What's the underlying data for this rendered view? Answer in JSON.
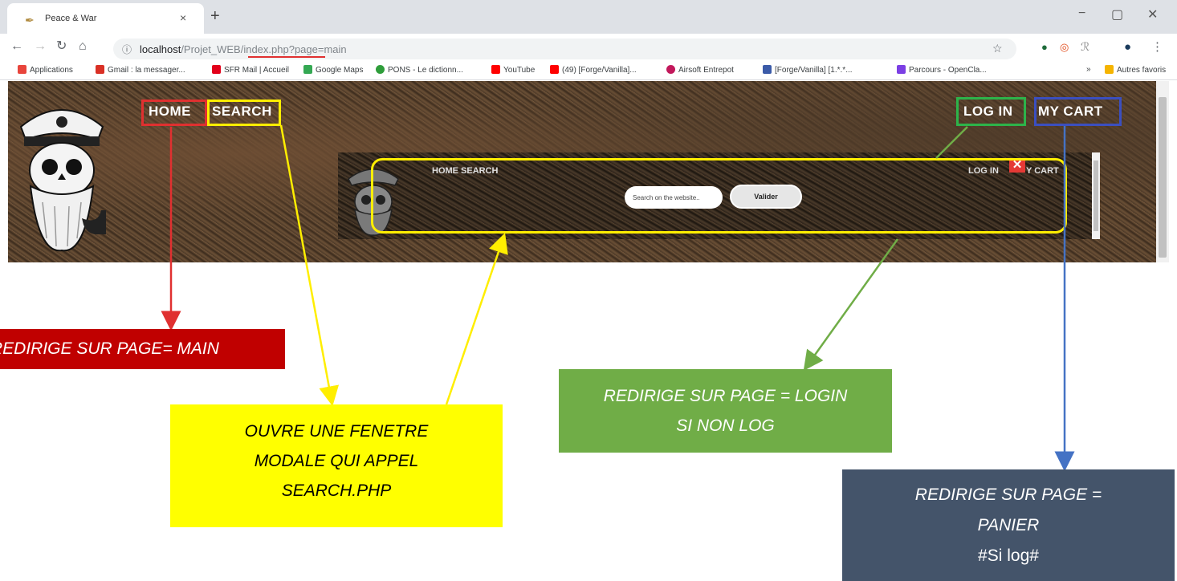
{
  "browser": {
    "tab_title": "Peace & War",
    "tab_close": "×",
    "new_tab": "+",
    "url_host": "localhost",
    "url_path": "/Projet_WEB/index.php?page=main",
    "window_controls": [
      "−",
      "▢",
      "✕"
    ],
    "icons": [
      "back-arrow-icon",
      "forward-arrow-icon",
      "reload-icon",
      "home-icon",
      "info-icon",
      "star-icon",
      "kebab-menu-icon"
    ]
  },
  "bookmarks": [
    {
      "label": "Applications",
      "color": "#e8453c"
    },
    {
      "label": "Gmail : la messager...",
      "color": "#d93025"
    },
    {
      "label": "SFR Mail | Accueil",
      "color": "#e2001a"
    },
    {
      "label": "Google Maps",
      "color": "#34a853"
    },
    {
      "label": "PONS - Le dictionn...",
      "color": "#2e9d3a"
    },
    {
      "label": "YouTube",
      "color": "#ff0000"
    },
    {
      "label": "(49) [Forge/Vanilla]...",
      "color": "#ff0000"
    },
    {
      "label": "Airsoft Entrepot",
      "color": "#c2185b"
    },
    {
      "label": "[Forge/Vanilla] [1.*.*...",
      "color": "#3b5ba8"
    },
    {
      "label": "Parcours - OpenCla...",
      "color": "#7b3fe4"
    },
    {
      "label": "»",
      "color": ""
    },
    {
      "label": "Autres favoris",
      "color": "#f5b400"
    }
  ],
  "site": {
    "nav_home": "HOME",
    "nav_search": "SEARCH",
    "nav_login": "LOG IN",
    "nav_cart": "MY CART"
  },
  "modal": {
    "nav_home_search": "HOME  SEARCH",
    "nav_login": "LOG IN",
    "nav_cart": "Y CART",
    "search_placeholder": "Search on the website..",
    "submit_label": "Valider",
    "close_label": "✕"
  },
  "annotations": {
    "home": "REDIRIGE SUR PAGE= MAIN",
    "search_line1": "OUVRE UNE FENETRE",
    "search_line2": "MODALE QUI APPEL",
    "search_line3": "SEARCH.PHP",
    "login_line1": "REDIRIGE SUR PAGE = LOGIN",
    "login_line2": "SI NON LOG",
    "cart_line1": "REDIRIGE SUR PAGE =",
    "cart_line2": "PANIER",
    "cart_line3": "#Si log#"
  },
  "colors": {
    "home": "#e03030",
    "search": "#ffee00",
    "login": "#2db34a",
    "cart": "#3b4fc0",
    "callout_red": "#c00000",
    "callout_yellow": "#ffff00",
    "callout_green": "#70ad47",
    "callout_slate": "#44546a"
  }
}
